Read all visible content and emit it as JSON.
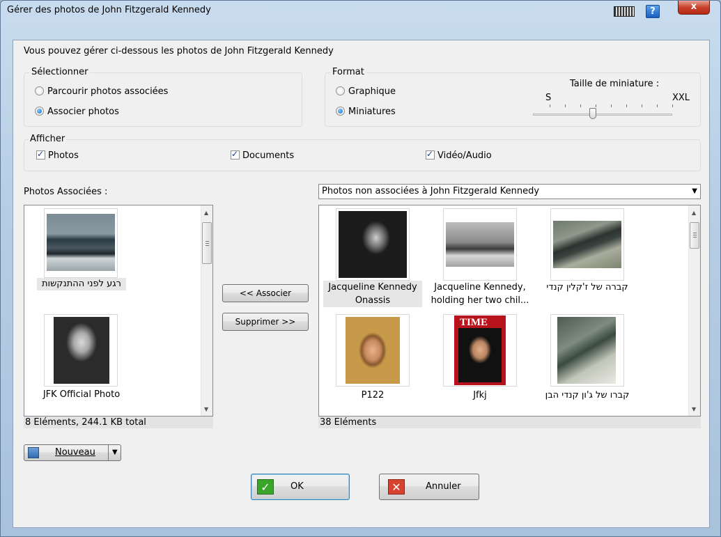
{
  "window": {
    "title": "Gérer des photos de John Fitzgerald Kennedy",
    "close": "x",
    "help": "?"
  },
  "intro": "Vous pouvez gérer ci-dessous les photos de John Fitzgerald Kennedy",
  "select_group": {
    "title": "Sélectionner",
    "options": [
      "Parcourir photos associées",
      "Associer photos"
    ],
    "selected": "Associer photos"
  },
  "format_group": {
    "title": "Format",
    "options": [
      "Graphique",
      "Miniatures"
    ],
    "selected": "Miniatures",
    "thumbnail_size_label": "Taille de miniature :",
    "min_label": "S",
    "max_label": "XXL",
    "slider_level": 0.35
  },
  "show_group": {
    "title": "Afficher",
    "photos": "Photos",
    "documents": "Documents",
    "video_audio": "Vidéo/Audio"
  },
  "associated": {
    "label": "Photos Associées :",
    "items": [
      {
        "caption": "רגע לפני ההתנקשות",
        "icon": "motorcade-photo"
      },
      {
        "caption": "JFK Official Photo",
        "icon": "portrait-photo"
      }
    ],
    "status": "8 Eléments, 244.1 KB total"
  },
  "middle_buttons": {
    "associate": "<< Associer",
    "remove": "Supprimer >>"
  },
  "unassociated": {
    "combo_value": "Photos non associées à John Fitzgerald Kennedy",
    "items": [
      {
        "caption_line1": "Jacqueline Kennedy",
        "caption_line2": "Onassis"
      },
      {
        "caption_line1": "Jacqueline Kennedy,",
        "caption_line2": "holding her two chil..."
      },
      {
        "caption_line1": "קברה של ז'קלין קנדי",
        "caption_line2": ""
      },
      {
        "caption_line1": "P122",
        "caption_line2": ""
      },
      {
        "caption_line1": "Jfkj",
        "caption_line2": ""
      },
      {
        "caption_line1": "קברו של ג'ון קנדי הבן",
        "caption_line2": ""
      }
    ],
    "status": "38 Eléments"
  },
  "new_button": "Nouveau",
  "ok_button": "OK",
  "cancel_button": "Annuler",
  "colors": {
    "titlebar": "#b6cde4",
    "close": "#c7412b",
    "ok_check": "#3aa52a",
    "cancel_x": "#d8432f",
    "selection": "#e6e6e6"
  }
}
